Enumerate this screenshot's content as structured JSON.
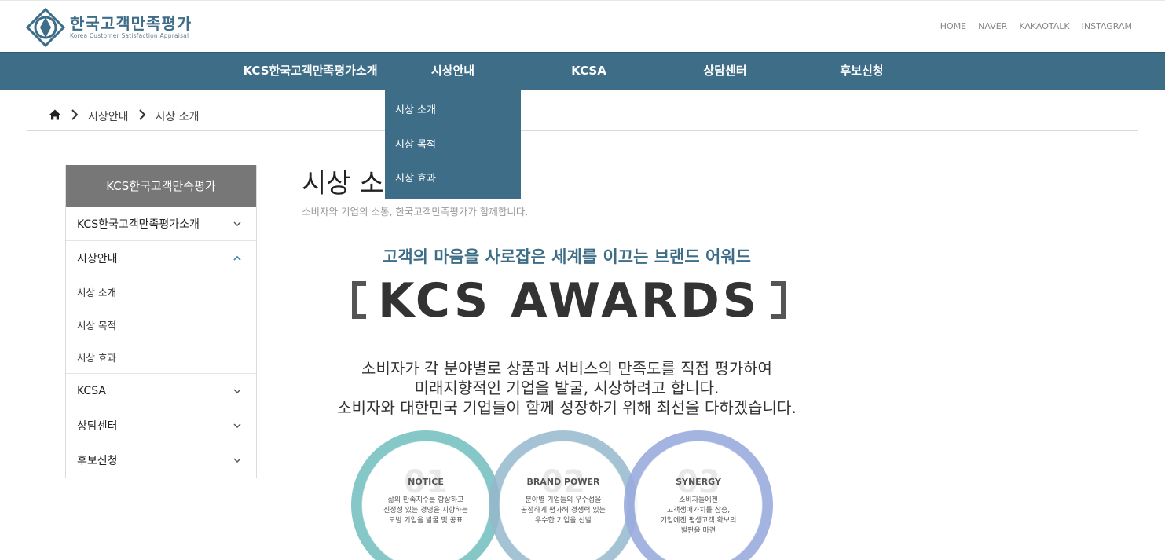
{
  "header": {
    "logo_title": "한국고객만족평가",
    "logo_subtitle": "Korea Customer Satisfaction Appraisal",
    "util_links": [
      "HOME",
      "NAVER",
      "KAKAOTALK",
      "INSTAGRAM"
    ]
  },
  "nav": {
    "items": [
      "KCS한국고객만족평가소개",
      "시상안내",
      "KCSA",
      "상담센터",
      "후보신청"
    ],
    "dropdown": [
      "시상 소개",
      "시상 목적",
      "시상 효과"
    ]
  },
  "breadcrumb": [
    "시상안내",
    "시상 소개"
  ],
  "sidebar": {
    "header": "KCS한국고객만족평가",
    "items": [
      {
        "label": "KCS한국고객만족평가소개"
      },
      {
        "label": "시상안내",
        "children": [
          "시상 소개",
          "시상 목적",
          "시상 효과"
        ]
      },
      {
        "label": "KCSA"
      },
      {
        "label": "상담센터"
      },
      {
        "label": "후보신청"
      }
    ]
  },
  "main": {
    "title": "시상 소개",
    "subtitle": "소비자와 기업의 소통, 한국고객만족평가가 함께합니다.",
    "hero_subtitle": "고객의 마음을 사로잡은 세계를 이끄는 브랜드 어워드",
    "hero_title": "KCS AWARDS",
    "description": [
      "소비자가 각 분야별로 상품과 서비스의 만족도를 직접 평가하여",
      "미래지향적인 기업을 발굴, 시상하려고 합니다.",
      "소비자와 대한민국 기업들이 함께 성장하기 위해 최선을 다하겠습니다."
    ],
    "circles": [
      {
        "number": "01",
        "title": "NOTICE",
        "text": [
          "삶의 만족지수를 향상하고",
          "진정성 있는 경영을 지향하는",
          "모범 기업을 발굴 및 공표"
        ],
        "color": "#7fc4c4"
      },
      {
        "number": "02",
        "title": "BRAND POWER",
        "text": [
          "분야별 기업들의 우수성을",
          "공정하게 평가해 경쟁력 있는",
          "우수한 기업을 선발"
        ],
        "color": "#94b8cc"
      },
      {
        "number": "03",
        "title": "SYNERGY",
        "text": [
          "소비자들에겐",
          "고객생애가치를 상승,",
          "기업에겐 평생고객 확보의",
          "발판을 마련"
        ],
        "color": "#9aabdd"
      }
    ]
  },
  "colors": {
    "primary": "#3e6e87",
    "sidebar_header": "#777777"
  }
}
